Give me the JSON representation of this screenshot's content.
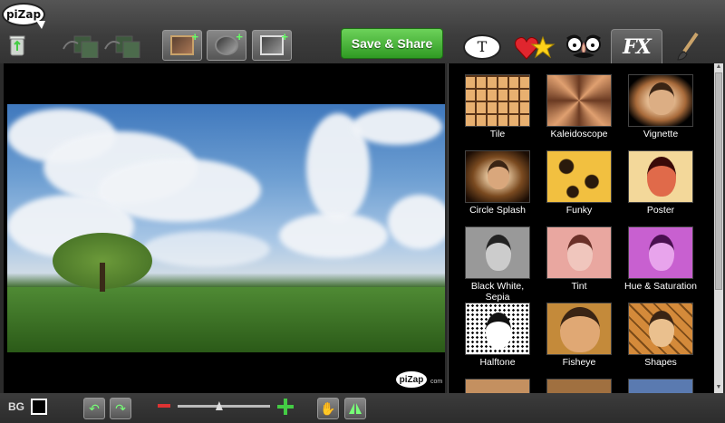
{
  "app": {
    "logo_text": "piZap",
    "watermark_text": "piZap",
    "watermark_suffix": "com"
  },
  "toolbar": {
    "save_label": "Save & Share",
    "tabs": [
      {
        "name": "text",
        "glyph": "T"
      },
      {
        "name": "stickers"
      },
      {
        "name": "disguise"
      },
      {
        "name": "fx",
        "glyph": "FX",
        "active": true
      },
      {
        "name": "paint"
      }
    ]
  },
  "effects": [
    {
      "label": "Tile"
    },
    {
      "label": "Kaleidoscope"
    },
    {
      "label": "Vignette"
    },
    {
      "label": "Circle Splash"
    },
    {
      "label": "Funky"
    },
    {
      "label": "Poster"
    },
    {
      "label": "Black White, Sepia"
    },
    {
      "label": "Tint"
    },
    {
      "label": "Hue & Saturation"
    },
    {
      "label": "Halftone"
    },
    {
      "label": "Fisheye"
    },
    {
      "label": "Shapes"
    }
  ],
  "bottom": {
    "bg_label": "BG",
    "zoom_level": 0.45
  },
  "colors": {
    "accent_green": "#3aa52b",
    "panel_bg": "#000000"
  }
}
